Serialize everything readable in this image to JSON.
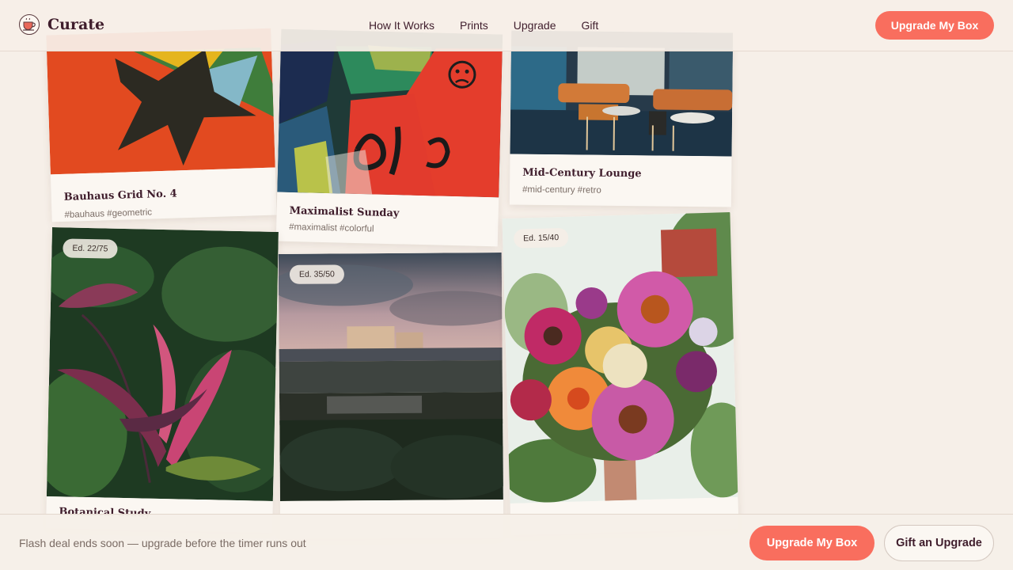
{
  "brand": {
    "name": "Curate",
    "logo_icon": "teacup-icon"
  },
  "nav": {
    "items": [
      {
        "label": "How It Works"
      },
      {
        "label": "Prints"
      },
      {
        "label": "Upgrade"
      },
      {
        "label": "Gift"
      }
    ],
    "cta_label": "Upgrade My Box"
  },
  "gallery": {
    "cards": [
      {
        "title": "Bauhaus Grid No. 4",
        "tags": "#bauhaus #geometric",
        "edition": ""
      },
      {
        "title": "Maximalist Sunday",
        "tags": "#maximalist #colorful",
        "edition": ""
      },
      {
        "title": "Mid-Century Lounge",
        "tags": "#mid-century #retro",
        "edition": ""
      },
      {
        "title": "Botanical Study",
        "tags": "",
        "edition": "Ed. 22/75"
      },
      {
        "title": "",
        "tags": "",
        "edition": "Ed. 35/50"
      },
      {
        "title": "",
        "tags": "",
        "edition": "Ed. 15/40"
      }
    ]
  },
  "footer": {
    "message": "Flash deal ends soon — upgrade before the timer runs out",
    "primary_label": "Upgrade My Box",
    "secondary_label": "Gift an Upgrade"
  },
  "colors": {
    "accent": "#f96e5e",
    "text": "#3f1d2c",
    "background": "#f6efe8"
  }
}
